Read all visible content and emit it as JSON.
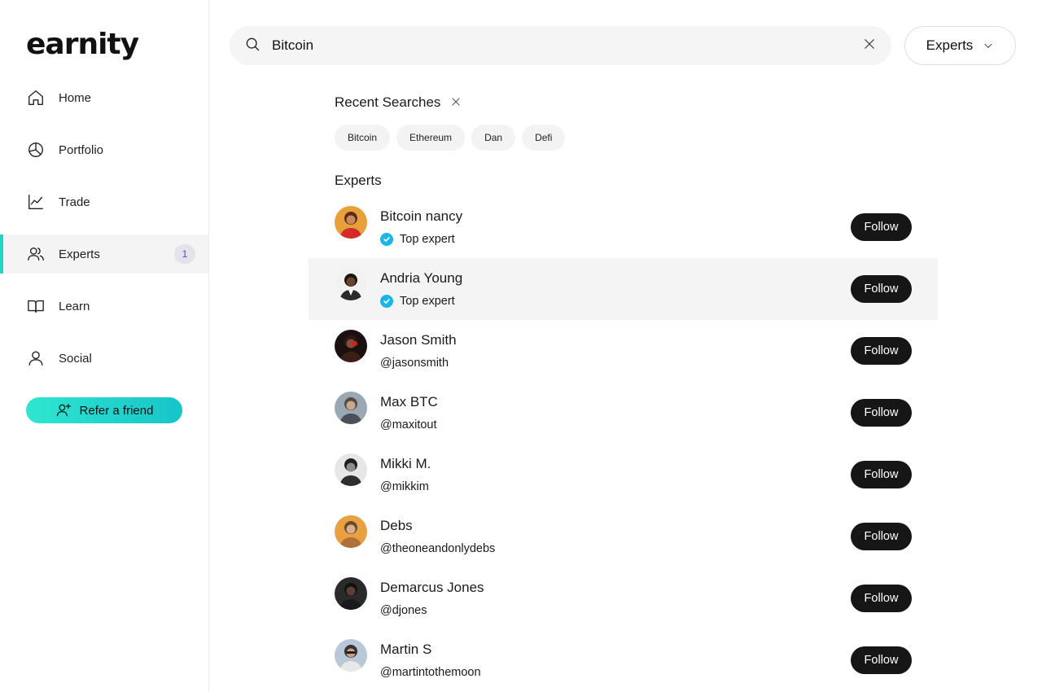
{
  "app": {
    "logo": "earnity"
  },
  "sidebar": {
    "items": [
      {
        "label": "Home",
        "icon": "home-icon"
      },
      {
        "label": "Portfolio",
        "icon": "pie-chart-icon"
      },
      {
        "label": "Trade",
        "icon": "trend-up-icon"
      },
      {
        "label": "Experts",
        "icon": "users-icon",
        "badge": "1",
        "active": true
      },
      {
        "label": "Learn",
        "icon": "book-icon"
      },
      {
        "label": "Social",
        "icon": "user-icon"
      }
    ],
    "refer_label": "Refer a friend"
  },
  "search": {
    "value": "Bitcoin",
    "placeholder": ""
  },
  "filter": {
    "label": "Experts"
  },
  "recent": {
    "title": "Recent Searches",
    "chips": [
      "Bitcoin",
      "Ethereum",
      "Dan",
      "Defi"
    ]
  },
  "experts": {
    "title": "Experts",
    "follow_label": "Follow",
    "rows": [
      {
        "name": "Bitcoin nancy",
        "sub": "Top expert",
        "verified": true
      },
      {
        "name": "Andria Young",
        "sub": "Top expert",
        "verified": true
      },
      {
        "name": "Jason Smith",
        "sub": "@jasonsmith",
        "verified": false
      },
      {
        "name": "Max BTC",
        "sub": "@maxitout",
        "verified": false
      },
      {
        "name": "Mikki M.",
        "sub": "@mikkim",
        "verified": false
      },
      {
        "name": "Debs",
        "sub": "@theoneandonlydebs",
        "verified": false
      },
      {
        "name": "Demarcus Jones",
        "sub": "@djones",
        "verified": false
      },
      {
        "name": "Martin S",
        "sub": "@martintothemoon",
        "verified": false
      }
    ]
  },
  "colors": {
    "accent": "#1fd6c4",
    "verified": "#1ab6e8",
    "follow_bg": "#161616",
    "badge_text": "#4b4bd6"
  }
}
